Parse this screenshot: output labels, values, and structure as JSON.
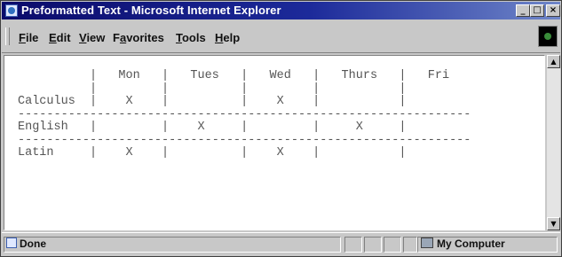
{
  "window": {
    "title": "Preformatted Text - Microsoft Internet Explorer",
    "controls": {
      "minimize": "_",
      "maximize": "□",
      "close": "×"
    }
  },
  "menu": {
    "items": [
      {
        "pre": "",
        "u": "F",
        "post": "ile"
      },
      {
        "pre": "",
        "u": "E",
        "post": "dit"
      },
      {
        "pre": "",
        "u": "V",
        "post": "iew"
      },
      {
        "pre": "F",
        "u": "a",
        "post": "vorites"
      },
      {
        "pre": "",
        "u": "T",
        "post": "ools"
      },
      {
        "pre": "",
        "u": "H",
        "post": "elp"
      }
    ]
  },
  "content": {
    "preformatted": "          |   Mon   |   Tues   |   Wed   |   Thurs   |   Fri\n          |         |          |         |           |\nCalculus  |    X    |          |    X    |           |\n---------------------------------------------------------------\nEnglish   |         |    X     |         |     X     |\n---------------------------------------------------------------\nLatin     |    X    |          |    X    |           |"
  },
  "scrollbar": {
    "up": "▲",
    "down": "▼"
  },
  "status": {
    "text": "Done",
    "zone": "My Computer"
  }
}
